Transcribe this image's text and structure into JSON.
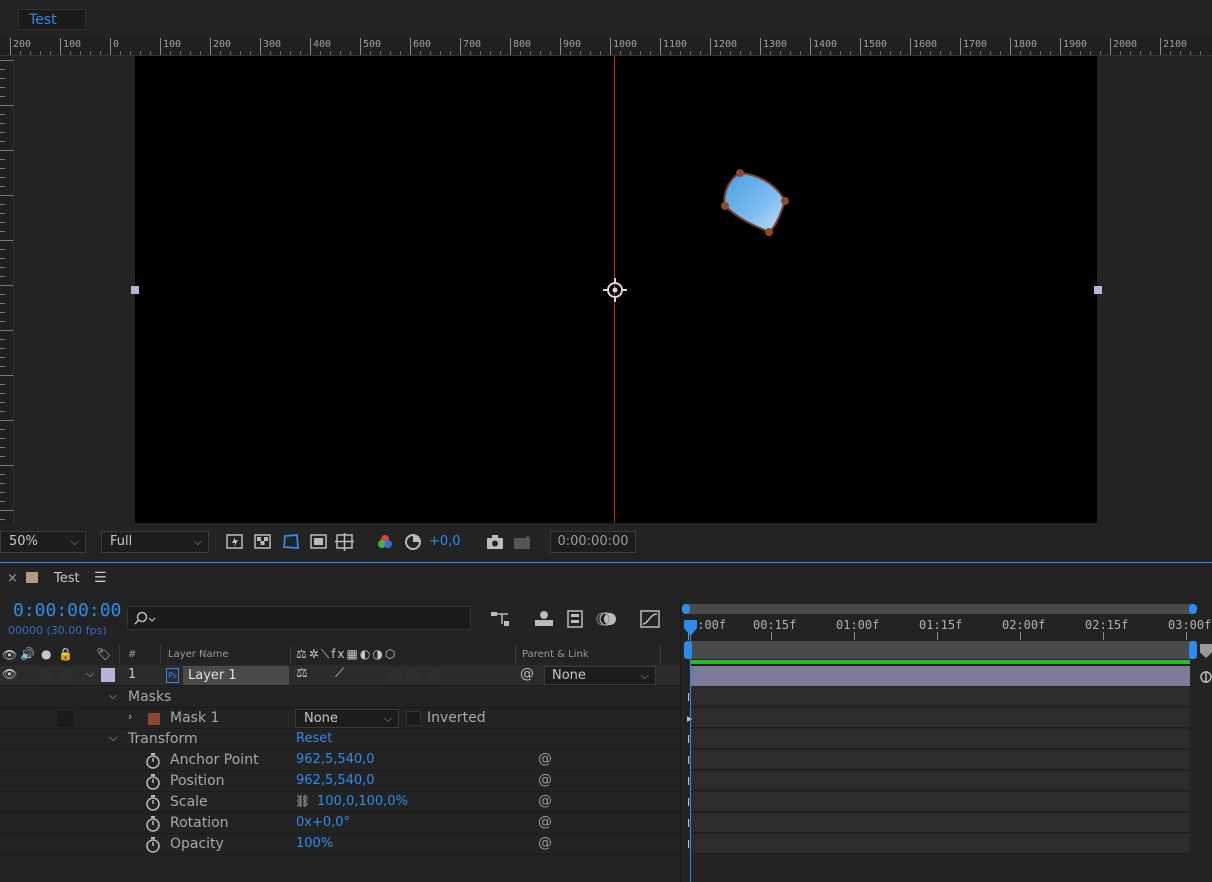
{
  "composition": {
    "tab_label": "Test",
    "ruler_labels": [
      "200",
      "100",
      "0",
      "100",
      "200",
      "300",
      "400",
      "500",
      "600",
      "700",
      "800",
      "900",
      "1000",
      "1100",
      "1200",
      "1300",
      "1400",
      "1500",
      "1600",
      "1700",
      "1800",
      "1900",
      "2000",
      "2100"
    ]
  },
  "viewer_toolbar": {
    "zoom": "50%",
    "resolution": "Full",
    "exposure": "+0,0",
    "timecode": "0:00:00:00"
  },
  "timeline": {
    "comp_name": "Test",
    "current_time": "0:00:00:00",
    "frame_info": "00000 (30.00 fps)",
    "columns": {
      "number": "#",
      "layer_name": "Layer Name",
      "parent_link": "Parent & Link"
    },
    "layer": {
      "index": "1",
      "name": "Layer 1",
      "parent": "None"
    },
    "masks_group": "Masks",
    "mask": {
      "name": "Mask 1",
      "mode": "None",
      "inverted_label": "Inverted",
      "color": "#8b4a2b"
    },
    "transform_group": "Transform",
    "reset_label": "Reset",
    "properties": [
      {
        "name": "Anchor Point",
        "value": "962,5,540,0"
      },
      {
        "name": "Position",
        "value": "962,5,540,0"
      },
      {
        "name": "Scale",
        "value": "100,0,100,0%"
      },
      {
        "name": "Rotation",
        "value": "0x+0,0°"
      },
      {
        "name": "Opacity",
        "value": "100%"
      }
    ],
    "time_ruler": [
      "0:00f",
      "00:15f",
      "01:00f",
      "01:15f",
      "02:00f",
      "02:15f",
      "03:00f"
    ]
  },
  "colors": {
    "accent": "#2d8ceb",
    "layer_label": "#b8b4d8",
    "comp_swatch": "#b29e7c",
    "layer_bar": "#7d7a98",
    "green_range": "#2fb52f",
    "guide_red": "#c0262b"
  },
  "icons": [
    "search-icon",
    "eye-icon",
    "audio-icon",
    "solo-icon",
    "lock-icon",
    "label-icon",
    "stopwatch-icon",
    "pick-whip-icon",
    "chevron-down-icon",
    "camera-icon",
    "color-channels-icon",
    "exposure-reset-icon",
    "anchor-point-icon",
    "flowchart-icon",
    "motion-blur-icon",
    "graph-editor-icon"
  ]
}
